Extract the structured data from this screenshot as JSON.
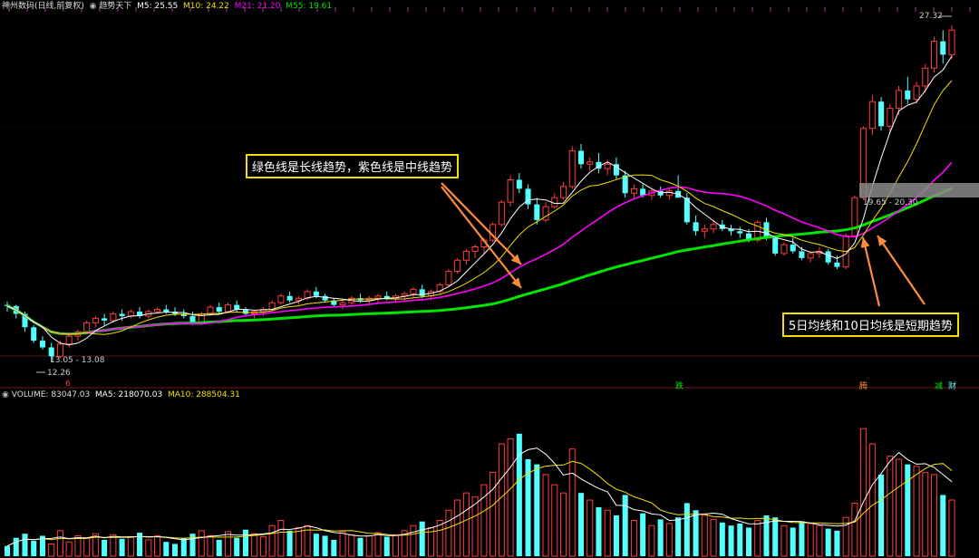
{
  "header": {
    "stock_name": "神州数码(日线,前复权)",
    "indicator_name": "趋势天下",
    "ma5_label": "M5: 25.55",
    "ma10_label": "M10: 24.22",
    "ma21_label": "M21: 21.20",
    "ma55_label": "M55: 19.61"
  },
  "volume_header": {
    "title": "VOLUME: 83047.03",
    "ma5_label": "MA5: 218070.03",
    "ma10_label": "MA10: 288504.31"
  },
  "annotations": {
    "long_mid_trend": "绿色线是长线趋势，紫色线是中线趋势",
    "short_trend": "5日均线和10日均线是短期趋势"
  },
  "price_labels": {
    "high": "27.32",
    "low": "12.26",
    "range_low": "13.05 - 13.08",
    "range_high": "19.65 - 20.30",
    "marker_six": "6"
  },
  "event_marks": [
    "跌",
    "腾",
    "减",
    "财"
  ],
  "colors": {
    "up": "#ff3c3c",
    "down": "#54ffff",
    "ma5": "#ffffff",
    "ma10": "#f0e000",
    "ma21": "#ff00ff",
    "ma55": "#00e400",
    "arrow": "#ff8c3c",
    "annotation_border": "#f2e000"
  },
  "chart_data": {
    "type": "candlestick",
    "title": "神州数码(日线,前复权)",
    "x_label": "",
    "y_label": "",
    "price_range": [
      11.5,
      27.8
    ],
    "series_names": [
      "M5",
      "M10",
      "M21",
      "M55"
    ],
    "ma_last": {
      "M5": 25.55,
      "M10": 24.22,
      "M21": 21.2,
      "M55": 19.61
    },
    "candles": [
      [
        14.8,
        14.95,
        14.5,
        14.75
      ],
      [
        14.75,
        14.8,
        14.2,
        14.4
      ],
      [
        14.4,
        14.5,
        13.6,
        13.8
      ],
      [
        13.8,
        13.9,
        13.1,
        13.2
      ],
      [
        13.2,
        13.4,
        12.8,
        12.9
      ],
      [
        12.9,
        13.1,
        12.26,
        12.5
      ],
      [
        12.5,
        13.2,
        12.4,
        13.05
      ],
      [
        13.05,
        13.5,
        12.9,
        13.4
      ],
      [
        13.4,
        13.7,
        13.2,
        13.6
      ],
      [
        13.6,
        14.1,
        13.5,
        14.0
      ],
      [
        14.0,
        14.3,
        13.8,
        14.2
      ],
      [
        14.2,
        14.4,
        13.9,
        14.1
      ],
      [
        14.1,
        14.5,
        14.0,
        14.4
      ],
      [
        14.4,
        14.6,
        14.1,
        14.3
      ],
      [
        14.3,
        14.6,
        14.2,
        14.5
      ],
      [
        14.5,
        14.7,
        14.2,
        14.3
      ],
      [
        14.3,
        14.6,
        14.2,
        14.5
      ],
      [
        14.5,
        14.7,
        14.4,
        14.6
      ],
      [
        14.6,
        14.8,
        14.4,
        14.5
      ],
      [
        14.5,
        14.7,
        14.3,
        14.4
      ],
      [
        14.4,
        14.6,
        14.2,
        14.3
      ],
      [
        14.3,
        14.5,
        13.9,
        14.0
      ],
      [
        14.0,
        14.5,
        13.9,
        14.4
      ],
      [
        14.4,
        14.8,
        14.3,
        14.7
      ],
      [
        14.7,
        14.9,
        14.4,
        14.5
      ],
      [
        14.5,
        14.9,
        14.4,
        14.8
      ],
      [
        14.8,
        15.0,
        14.5,
        14.6
      ],
      [
        14.6,
        14.7,
        14.3,
        14.4
      ],
      [
        14.4,
        14.6,
        14.2,
        14.5
      ],
      [
        14.5,
        14.7,
        14.3,
        14.6
      ],
      [
        14.6,
        15.0,
        14.5,
        14.9
      ],
      [
        14.9,
        15.3,
        14.8,
        15.2
      ],
      [
        15.2,
        15.4,
        14.9,
        15.0
      ],
      [
        15.0,
        15.2,
        14.8,
        15.1
      ],
      [
        15.1,
        15.5,
        15.0,
        15.4
      ],
      [
        15.4,
        15.6,
        15.1,
        15.2
      ],
      [
        15.2,
        15.3,
        14.9,
        15.0
      ],
      [
        15.0,
        15.1,
        14.7,
        14.8
      ],
      [
        14.8,
        15.0,
        14.6,
        14.9
      ],
      [
        14.9,
        15.2,
        14.8,
        15.1
      ],
      [
        15.1,
        15.3,
        14.9,
        15.0
      ],
      [
        15.0,
        15.2,
        14.8,
        15.1
      ],
      [
        15.1,
        15.3,
        14.9,
        15.2
      ],
      [
        15.2,
        15.4,
        15.0,
        15.1
      ],
      [
        15.1,
        15.3,
        14.9,
        15.2
      ],
      [
        15.2,
        15.4,
        15.0,
        15.3
      ],
      [
        15.3,
        15.6,
        15.1,
        15.5
      ],
      [
        15.5,
        15.7,
        15.1,
        15.2
      ],
      [
        15.2,
        15.5,
        15.0,
        15.4
      ],
      [
        15.4,
        15.8,
        15.3,
        15.7
      ],
      [
        15.7,
        16.4,
        15.6,
        16.3
      ],
      [
        16.3,
        16.9,
        16.2,
        16.8
      ],
      [
        16.8,
        17.3,
        16.6,
        17.2
      ],
      [
        17.2,
        17.5,
        16.9,
        17.4
      ],
      [
        17.4,
        17.8,
        17.1,
        17.7
      ],
      [
        17.7,
        18.5,
        17.6,
        18.4
      ],
      [
        18.4,
        19.5,
        18.3,
        19.4
      ],
      [
        19.4,
        20.6,
        19.2,
        20.4
      ],
      [
        20.4,
        20.7,
        19.8,
        20.0
      ],
      [
        20.0,
        20.2,
        19.1,
        19.3
      ],
      [
        19.3,
        19.6,
        18.4,
        18.6
      ],
      [
        18.6,
        19.4,
        18.5,
        19.2
      ],
      [
        19.2,
        19.8,
        19.1,
        19.6
      ],
      [
        19.6,
        20.3,
        19.5,
        20.1
      ],
      [
        20.1,
        21.9,
        20.0,
        21.7
      ],
      [
        21.7,
        22.0,
        20.9,
        21.1
      ],
      [
        21.1,
        21.4,
        20.8,
        21.2
      ],
      [
        21.2,
        21.6,
        20.7,
        20.9
      ],
      [
        20.9,
        21.3,
        20.6,
        21.1
      ],
      [
        21.1,
        21.4,
        20.4,
        20.6
      ],
      [
        20.6,
        20.8,
        19.6,
        19.8
      ],
      [
        19.8,
        20.2,
        19.5,
        20.0
      ],
      [
        20.0,
        20.2,
        19.6,
        19.7
      ],
      [
        19.7,
        20.0,
        19.5,
        19.9
      ],
      [
        19.9,
        20.1,
        19.6,
        19.7
      ],
      [
        19.7,
        20.0,
        19.5,
        19.9
      ],
      [
        19.9,
        20.6,
        19.7,
        19.6
      ],
      [
        19.6,
        19.8,
        18.4,
        18.5
      ],
      [
        18.5,
        18.8,
        17.9,
        18.1
      ],
      [
        18.1,
        18.4,
        17.8,
        18.2
      ],
      [
        18.2,
        18.6,
        18.0,
        18.4
      ],
      [
        18.4,
        18.6,
        18.1,
        18.2
      ],
      [
        18.2,
        18.4,
        17.9,
        18.1
      ],
      [
        18.1,
        18.3,
        17.8,
        18.0
      ],
      [
        18.0,
        18.2,
        17.6,
        17.7
      ],
      [
        17.7,
        18.6,
        17.6,
        18.5
      ],
      [
        18.5,
        18.7,
        17.7,
        17.8
      ],
      [
        17.8,
        17.9,
        17.0,
        17.1
      ],
      [
        17.1,
        17.6,
        17.0,
        17.5
      ],
      [
        17.5,
        17.8,
        17.1,
        17.2
      ],
      [
        17.2,
        17.4,
        16.8,
        16.9
      ],
      [
        16.9,
        17.2,
        16.7,
        17.1
      ],
      [
        17.1,
        17.4,
        16.9,
        17.2
      ],
      [
        17.2,
        17.3,
        16.6,
        16.7
      ],
      [
        16.7,
        17.0,
        16.4,
        16.5
      ],
      [
        16.5,
        18.0,
        16.4,
        17.9
      ],
      [
        17.9,
        19.7,
        17.8,
        19.6
      ],
      [
        19.6,
        22.8,
        19.5,
        22.7
      ],
      [
        22.7,
        24.2,
        22.4,
        23.9
      ],
      [
        23.9,
        24.1,
        22.6,
        22.8
      ],
      [
        22.8,
        23.8,
        22.5,
        23.6
      ],
      [
        23.6,
        24.6,
        23.3,
        24.4
      ],
      [
        24.4,
        25.0,
        23.8,
        24.0
      ],
      [
        24.0,
        24.8,
        23.8,
        24.6
      ],
      [
        24.6,
        25.6,
        24.3,
        25.4
      ],
      [
        25.4,
        26.8,
        25.2,
        26.6
      ],
      [
        26.6,
        27.1,
        25.6,
        26.0
      ],
      [
        26.0,
        27.32,
        25.8,
        27.1
      ]
    ],
    "volume_range": [
      0,
      150000
    ],
    "volumes": [
      10000,
      18000,
      22000,
      15000,
      20000,
      12000,
      25000,
      14000,
      20000,
      18000,
      22000,
      16000,
      21000,
      17000,
      19000,
      23000,
      16000,
      20000,
      14000,
      12000,
      18000,
      22000,
      25000,
      20000,
      16000,
      24000,
      18000,
      26000,
      22000,
      19000,
      30000,
      35000,
      25000,
      28000,
      30000,
      22000,
      20000,
      16000,
      24000,
      21000,
      18000,
      20000,
      23000,
      19000,
      21000,
      25000,
      30000,
      34000,
      28000,
      35000,
      45000,
      55000,
      62000,
      58000,
      70000,
      82000,
      110000,
      115000,
      120000,
      95000,
      90000,
      80000,
      70000,
      62000,
      105000,
      62000,
      55000,
      48000,
      45000,
      40000,
      60000,
      35000,
      42000,
      30000,
      36000,
      32000,
      38000,
      52000,
      45000,
      40000,
      36000,
      33000,
      30000,
      32000,
      28000,
      35000,
      40000,
      38000,
      30000,
      28000,
      34000,
      32000,
      30000,
      27000,
      25000,
      38000,
      52000,
      125000,
      110000,
      80000,
      98000,
      95000,
      90000,
      88000,
      82000,
      80000,
      60000,
      55000
    ],
    "volume_directions": [
      "d",
      "d",
      "d",
      "d",
      "d",
      "u",
      "u",
      "u",
      "u",
      "u",
      "u",
      "d",
      "u",
      "d",
      "u",
      "d",
      "u",
      "u",
      "d",
      "d",
      "d",
      "d",
      "u",
      "u",
      "d",
      "u",
      "d",
      "d",
      "u",
      "u",
      "u",
      "u",
      "d",
      "u",
      "u",
      "d",
      "d",
      "d",
      "u",
      "u",
      "d",
      "u",
      "u",
      "d",
      "u",
      "u",
      "u",
      "d",
      "u",
      "u",
      "u",
      "u",
      "u",
      "u",
      "u",
      "u",
      "u",
      "u",
      "d",
      "d",
      "d",
      "u",
      "u",
      "u",
      "u",
      "d",
      "u",
      "d",
      "u",
      "d",
      "d",
      "u",
      "d",
      "u",
      "d",
      "u",
      "d",
      "d",
      "d",
      "u",
      "u",
      "d",
      "d",
      "d",
      "d",
      "u",
      "d",
      "d",
      "u",
      "d",
      "d",
      "u",
      "u",
      "d",
      "d",
      "u",
      "u",
      "u",
      "u",
      "d",
      "u",
      "u",
      "d",
      "u",
      "u",
      "u",
      "d",
      "u"
    ]
  }
}
